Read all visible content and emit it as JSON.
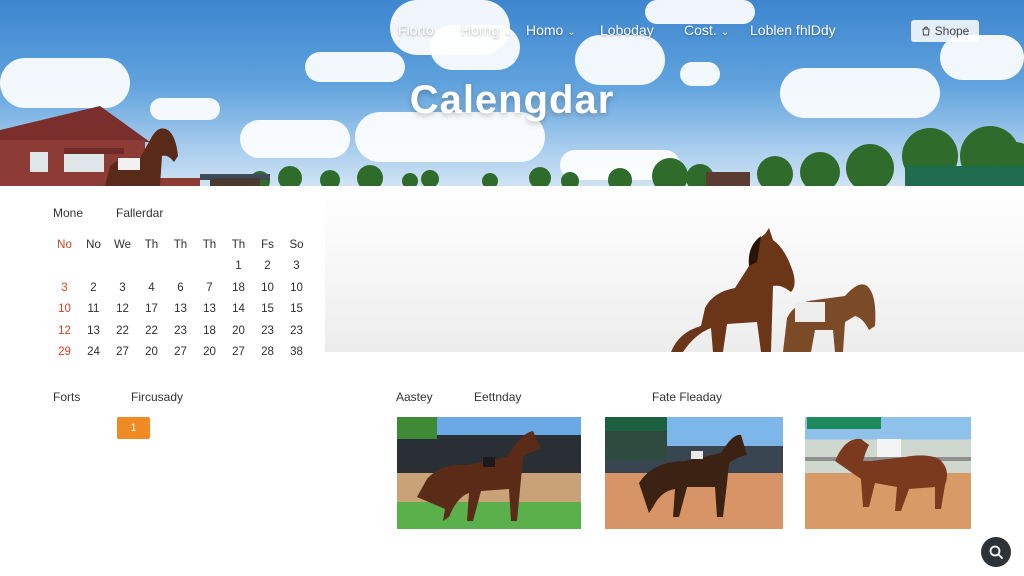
{
  "nav": {
    "items": [
      {
        "label": "Florto",
        "has_dropdown": false
      },
      {
        "label": "Horng",
        "has_dropdown": true
      },
      {
        "label": "Homo",
        "has_dropdown": true
      },
      {
        "label": "Loboday",
        "has_dropdown": false
      },
      {
        "label": "Cost.",
        "has_dropdown": true
      },
      {
        "label": "Loblen fhlDdy",
        "has_dropdown": false
      }
    ],
    "shop_label": "Shope",
    "shop_icon": "bag-icon"
  },
  "hero": {
    "title": "Calengdar"
  },
  "calendar": {
    "heading_left": "Mone",
    "heading_right": "Fallerdar",
    "weekdays": [
      "No",
      "No",
      "We",
      "Th",
      "Th",
      "Th",
      "Th",
      "Fs",
      "So"
    ],
    "rows": [
      [
        "",
        "",
        "",
        "",
        "",
        "",
        "1",
        "2",
        "3"
      ],
      [
        "3",
        "2",
        "3",
        "4",
        "6",
        "7",
        "18",
        "10",
        "10"
      ],
      [
        "10",
        "11",
        "12",
        "17",
        "13",
        "13",
        "14",
        "15",
        "15"
      ],
      [
        "12",
        "13",
        "22",
        "22",
        "23",
        "18",
        "20",
        "23",
        "23"
      ],
      [
        "29",
        "24",
        "27",
        "20",
        "27",
        "20",
        "27",
        "28",
        "38"
      ]
    ],
    "accent_color": "#d8431f"
  },
  "lower": {
    "label_forts": "Forts",
    "label_fircusady": "Fircusady",
    "orange_button": "1",
    "label_aastey": "Aastey",
    "label_eettnday": "Eettnday",
    "label_fate": "Fate Fleaday"
  },
  "colors": {
    "accent": "#f08a24",
    "sky": "#4a90d9"
  },
  "fab_icon": "search-icon"
}
